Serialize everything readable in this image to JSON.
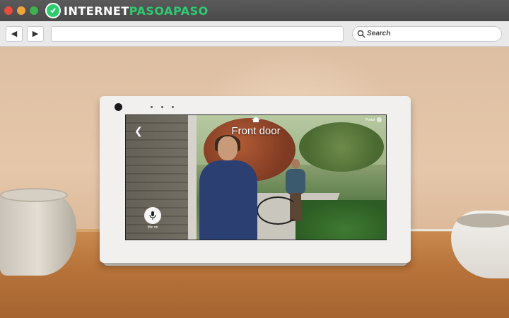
{
  "browser": {
    "logo_prefix": "INTERNET",
    "logo_accent": "PASOAPASO",
    "search_placeholder": "Search",
    "colors": {
      "close": "#e74c3c",
      "minimize": "#f0a53a",
      "maximize": "#3fb04f",
      "brand": "#2ecc71"
    },
    "icons": [
      "back-arrow-icon",
      "forward-arrow-icon",
      "search-icon"
    ]
  },
  "device_screen": {
    "title": "Front door",
    "mic_label": "Mic on",
    "status_text": "Portal"
  }
}
